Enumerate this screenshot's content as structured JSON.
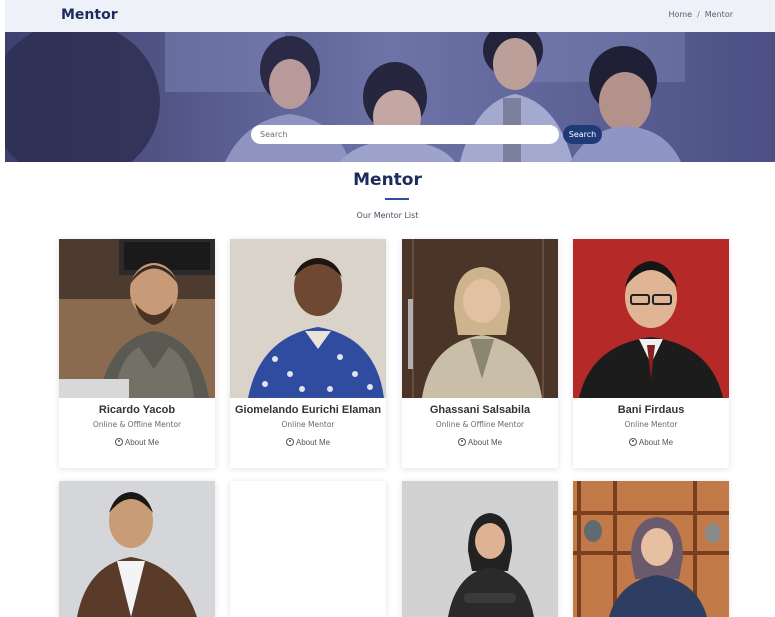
{
  "header": {
    "brand": "Mentor",
    "breadcrumb": {
      "home": "Home",
      "separator": "/",
      "current": "Mentor"
    }
  },
  "hero": {
    "search_placeholder": "Search",
    "search_button": "Search"
  },
  "section": {
    "title": "Mentor",
    "subtitle": "Our Mentor List"
  },
  "about_label": "About Me",
  "mentors": [
    {
      "name": "Ricardo Yacob",
      "role": "Online & Offline Mentor"
    },
    {
      "name": "Giomelando Eurichi Elaman",
      "role": "Online Mentor"
    },
    {
      "name": "Ghassani Salsabila",
      "role": "Online & Offline Mentor"
    },
    {
      "name": "Bani Firdaus",
      "role": "Online Mentor"
    }
  ],
  "colors": {
    "brand": "#1c2c5c",
    "accent": "#1f3a78",
    "hero_overlay": "#4a4f86"
  },
  "icons": [
    "user-circle-icon"
  ]
}
